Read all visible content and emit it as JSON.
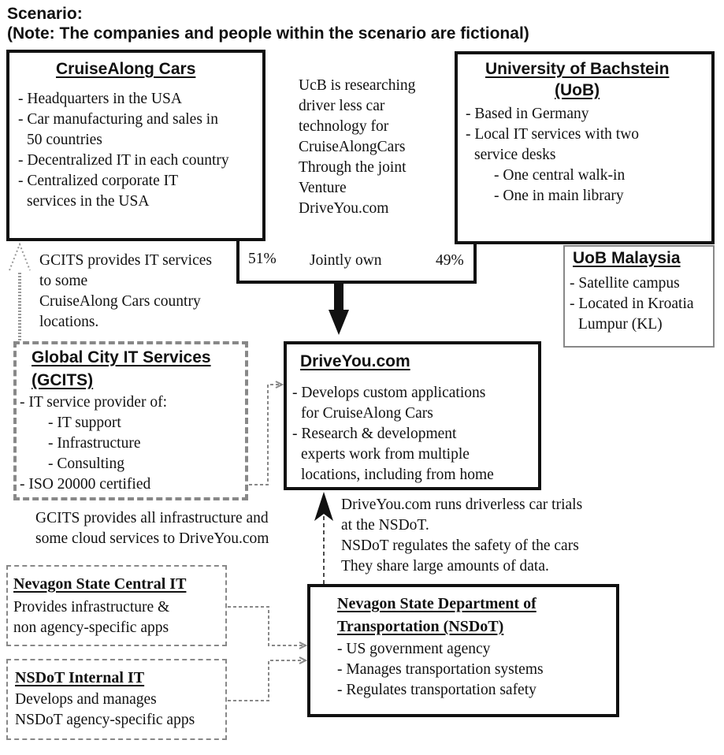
{
  "header": {
    "title": "Scenario:",
    "note": "(Note: The companies and people within the scenario are fictional)"
  },
  "cruisealong": {
    "title": "CruiseAlong Cars",
    "lines": [
      "- Headquarters in the USA",
      "- Car manufacturing and sales in",
      "50 countries",
      "- Decentralized IT in each country",
      "- Centralized corporate IT",
      "services in the USA"
    ]
  },
  "ucb_note": {
    "lines": [
      "UcB is researching",
      "driver less car",
      "technology for",
      "CruiseAlongCars",
      "Through the joint",
      "Venture",
      "DriveYou.com"
    ]
  },
  "uob": {
    "title_line1": "University of Bachstein",
    "title_line2": "(UoB)",
    "lines": [
      "- Based in Germany",
      "- Local IT services with two",
      "service desks",
      "- One central walk-in",
      "- One in main library"
    ]
  },
  "uob_malaysia": {
    "title": "UoB Malaysia",
    "lines": [
      "- Satellite campus",
      "- Located in Kroatia",
      "Lumpur (KL)"
    ]
  },
  "ownership": {
    "left_pct": "51%",
    "label": "Jointly own",
    "right_pct": "49%"
  },
  "gcits_cruise_note": {
    "lines": [
      "GCITS provides IT services",
      "to some",
      "CruiseAlong Cars country",
      "locations."
    ]
  },
  "gcits": {
    "title_line1": "Global City IT Services",
    "title_line2": "(GCITS)",
    "lines": [
      "- IT service provider of:",
      "- IT support",
      "- Infrastructure",
      "- Consulting",
      "- ISO 20000 certified"
    ]
  },
  "driveyou": {
    "title": "DriveYou.com",
    "lines": [
      "- Develops custom applications",
      "for CruiseAlong Cars",
      "- Research & development",
      "experts work from multiple",
      "locations, including from home"
    ]
  },
  "gcits_driveyou_note": {
    "lines": [
      "GCITS provides all infrastructure and",
      "some cloud services to DriveYou.com"
    ]
  },
  "nsdot_note": {
    "lines": [
      "DriveYou.com runs driverless car trials",
      "at the NSDoT.",
      "NSDoT regulates the safety of the cars",
      "They share large amounts of data."
    ]
  },
  "nevagon_central": {
    "title": "Nevagon State Central IT",
    "lines": [
      "Provides infrastructure &",
      "non agency-specific apps"
    ]
  },
  "nsdot_internal": {
    "title": "NSDoT Internal IT",
    "lines": [
      "Develops and manages",
      "NSDoT agency-specific apps"
    ]
  },
  "nsdot": {
    "title_line1": "Nevagon State Department of",
    "title_line2": "Transportation (NSDoT)",
    "lines": [
      "- US government agency",
      "- Manages transportation systems",
      "- Regulates transportation safety"
    ]
  }
}
